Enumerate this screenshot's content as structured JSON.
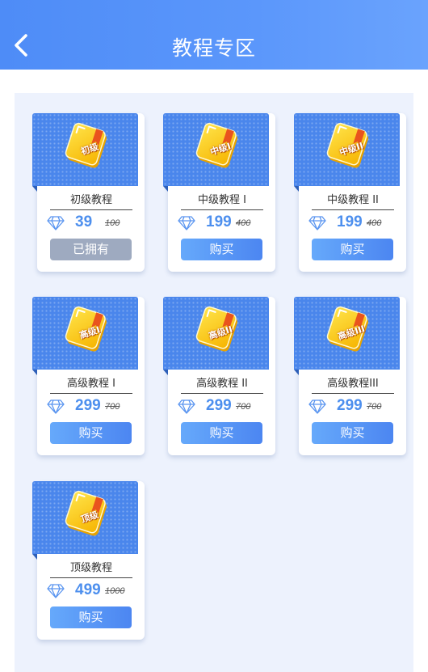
{
  "header": {
    "title": "教程专区",
    "back_icon": "chevron-left-icon"
  },
  "colors": {
    "header": "#5393f9",
    "accent": "#4d8fee",
    "panel": "#edf2fd",
    "owned_button": "#9eaac0"
  },
  "courses": [
    {
      "badge": "初级",
      "name": "初级教程",
      "price": "39",
      "original_price": "100",
      "action": "已拥有",
      "owned": true
    },
    {
      "badge": "中级I",
      "name": "中级教程 I",
      "price": "199",
      "original_price": "400",
      "action": "购买",
      "owned": false
    },
    {
      "badge": "中级II",
      "name": "中级教程 II",
      "price": "199",
      "original_price": "400",
      "action": "购买",
      "owned": false
    },
    {
      "badge": "高级I",
      "name": "高级教程 I",
      "price": "299",
      "original_price": "700",
      "action": "购买",
      "owned": false
    },
    {
      "badge": "高级II",
      "name": "高级教程 II",
      "price": "299",
      "original_price": "700",
      "action": "购买",
      "owned": false
    },
    {
      "badge": "高级III",
      "name": "高级教程III",
      "price": "299",
      "original_price": "700",
      "action": "购买",
      "owned": false
    },
    {
      "badge": "顶级",
      "name": "顶级教程",
      "price": "499",
      "original_price": "1000",
      "action": "购买",
      "owned": false
    }
  ]
}
